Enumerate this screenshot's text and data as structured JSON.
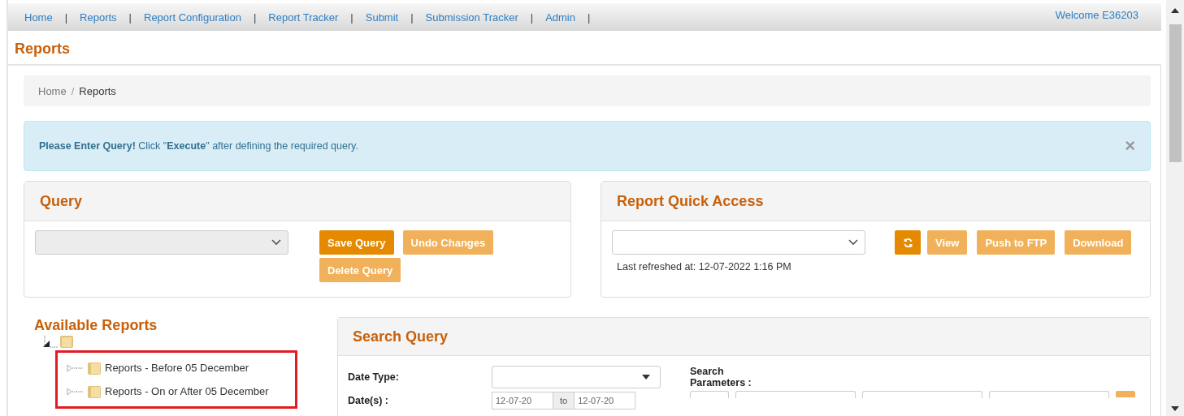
{
  "nav": {
    "items": [
      {
        "label": "Home"
      },
      {
        "label": "Reports"
      },
      {
        "label": "Report Configuration"
      },
      {
        "label": "Report Tracker"
      },
      {
        "label": "Submit"
      },
      {
        "label": "Submission Tracker"
      },
      {
        "label": "Admin"
      }
    ],
    "separator": "|",
    "welcome": "Welcome E36203"
  },
  "page_title": "Reports",
  "breadcrumb": [
    {
      "label": "Home",
      "selected": false
    },
    {
      "label": "Reports",
      "selected": true
    }
  ],
  "breadcrumb_separator": "/",
  "alert": {
    "text": "**Please Enter Query!** Click \"**Execute**\" after defining the required query.",
    "close": "×"
  },
  "query": {
    "title": "Query",
    "buttons": [
      {
        "label": "Save Query",
        "disabled": false
      },
      {
        "label": "Undo Changes",
        "disabled": true
      },
      {
        "label": "Delete Query",
        "disabled": true
      }
    ]
  },
  "quick_access": {
    "title": "Report Quick Access",
    "buttons": [
      {
        "kind": "refresh",
        "disabled": false
      },
      {
        "kind": "text",
        "label": "View",
        "disabled": true
      },
      {
        "kind": "text",
        "label": "Push to FTP",
        "disabled": true
      },
      {
        "kind": "text",
        "label": "Download",
        "disabled": true
      }
    ],
    "last_refreshed": "Last refreshed at: 12-07-2022 1:16 PM"
  },
  "available_reports": {
    "title": "Available Reports",
    "highlighted": true,
    "tree": {
      "expanded": true,
      "children": [
        {
          "label": "Reports - Before 05 December",
          "expanded": false
        },
        {
          "label": "Reports - On or After 05 December",
          "expanded": false
        }
      ]
    }
  },
  "search_query": {
    "title": "Search Query",
    "date_type_label": "Date Type:",
    "dates_label": "Date(s) :",
    "date_from": "12-07-20",
    "date_to_label": "to",
    "date_to": "12-07-20",
    "search_parameters_label": "Search Parameters :"
  }
}
